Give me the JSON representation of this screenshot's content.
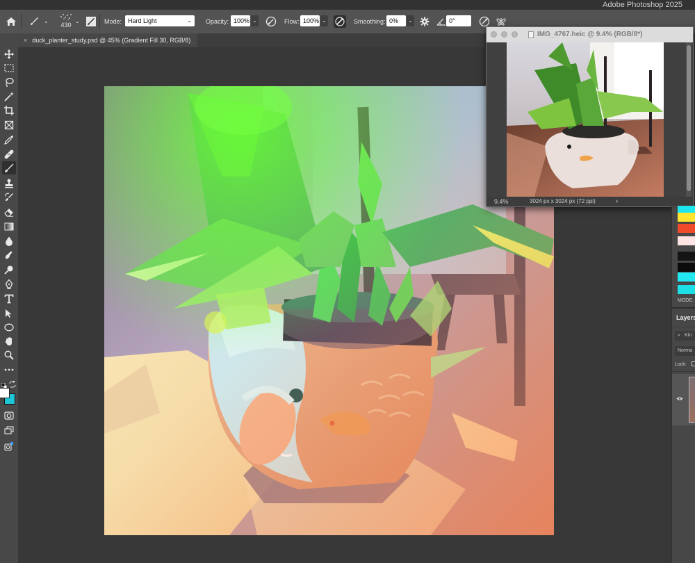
{
  "app_title": "Adobe Photoshop 2025",
  "options_bar": {
    "brush_size": "430",
    "mode_label": "Mode:",
    "mode_value": "Hard Light",
    "opacity_label": "Opacity:",
    "opacity_value": "100%",
    "flow_label": "Flow:",
    "flow_value": "100%",
    "smoothing_label": "Smoothing:",
    "smoothing_value": "0%",
    "angle_value": "0°"
  },
  "document_tab": {
    "close_glyph": "×",
    "title": "duck_planter_study.psd @ 45% (Gradient Fill 30, RGB/8)"
  },
  "reference_window": {
    "title": "IMG_4767.heic @ 9.4% (RGB/8*)",
    "zoom": "9.4%",
    "info": "3024 px x 3024 px (72 ppi)",
    "arrow": "›"
  },
  "panels": {
    "swatch_colors": [
      "#1ee6f0",
      "#ffe530",
      "#f04a2a",
      "#ffe4e4",
      "#141414",
      "#0b0b0b",
      "#22e8f2",
      "#1ddfe8"
    ],
    "mode_label": "MODE:",
    "layers_title": "Layers",
    "layers_kind": "Kin",
    "blend_mode": "Norma",
    "lock_label": "Lock:"
  },
  "tools": {
    "foreground_color": "#ffffff",
    "background_color": "#1ec6d6"
  }
}
